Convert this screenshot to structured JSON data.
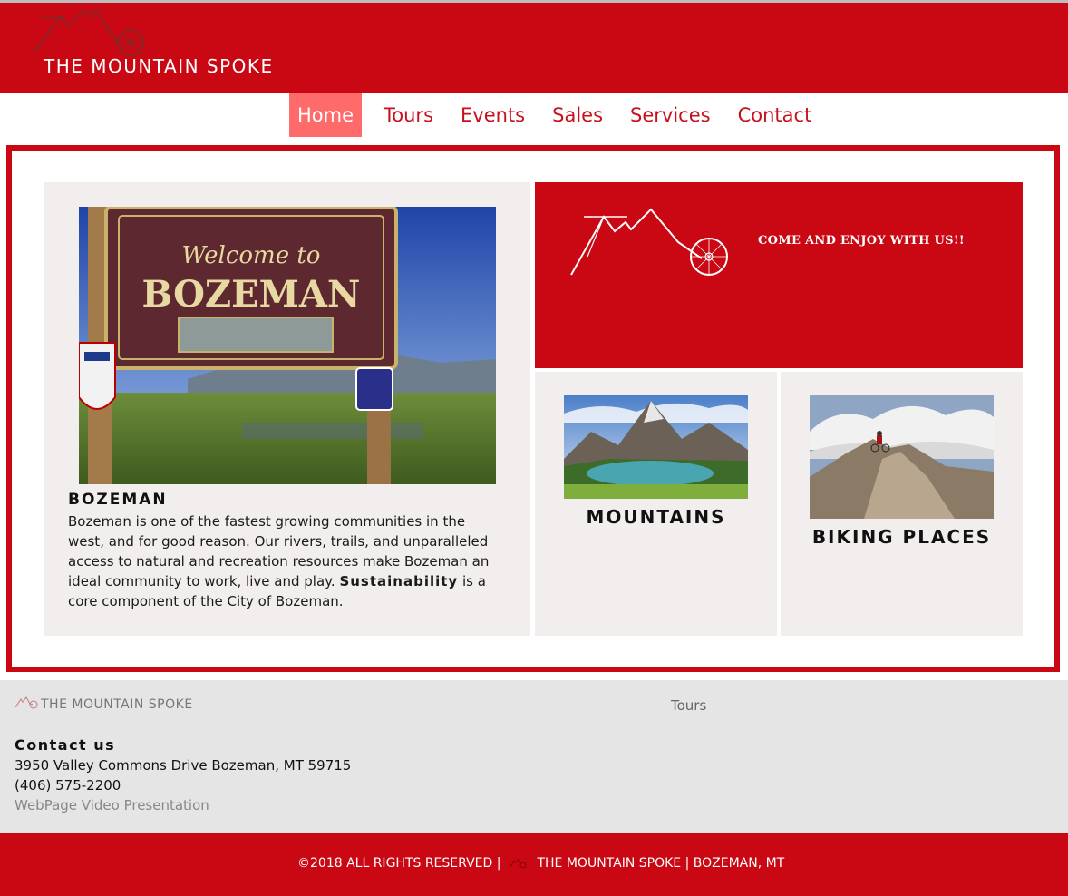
{
  "header": {
    "logo_icon": "mountain-bike-logo-icon",
    "site_title": "THE MOUNTAIN SPOKE"
  },
  "nav": {
    "items": [
      {
        "label": "Home",
        "active": true
      },
      {
        "label": "Tours",
        "active": false
      },
      {
        "label": "Events",
        "active": false
      },
      {
        "label": "Sales",
        "active": false
      },
      {
        "label": "Services",
        "active": false
      },
      {
        "label": "Contact",
        "active": false
      }
    ]
  },
  "intro": {
    "photo": "welcome-to-bozeman-sign-photo",
    "heading": "BOZEMAN",
    "body_before": "Bozeman is one of the fastest growing communities in the west, and for good reason. Our rivers, trails, and unparalleled access to natural and recreation resources make Bozeman an ideal community to work, live and play.",
    "body_bold": "Sustainability",
    "body_after": "is a core component of the City of Bozeman."
  },
  "promo": {
    "logo_icon": "mountain-bike-logo-icon",
    "text": "COME AND ENJOY WITH US!!"
  },
  "cards": {
    "mountains": {
      "title": "MOUNTAINS",
      "image": "mountain-lake-photo"
    },
    "biking": {
      "title": "BIKING PLACES",
      "image": "mountain-biker-ridge-photo"
    }
  },
  "footer": {
    "brand": "THE MOUNTAIN SPOKE",
    "tours_link": "Tours",
    "contact_heading": "Contact us",
    "address": "3950 Valley Commons Drive Bozeman, MT 59715",
    "phone": "(406) 575-2200",
    "video_link": "WebPage Video Presentation"
  },
  "bottom_bar": {
    "copyright_left": "©2018 ALL RIGHTS RESERVED |",
    "copyright_right": "THE MOUNTAIN SPOKE | BOZEMAN, MT"
  },
  "colors": {
    "brand_red": "#ca0813",
    "nav_active": "#ff6b6b",
    "panel_bg": "#f3eeee",
    "footer_bg": "#e5e5e5"
  }
}
